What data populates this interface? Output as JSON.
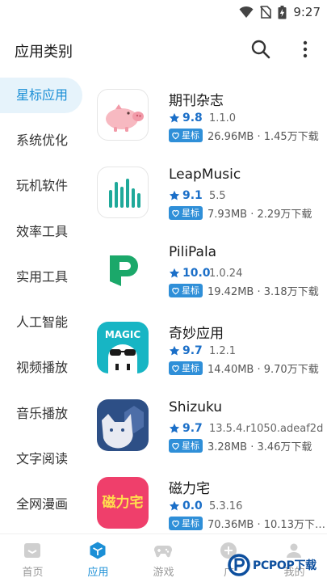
{
  "status_bar": {
    "time": "9:27"
  },
  "header": {
    "title": "应用类别"
  },
  "sidebar": {
    "items": [
      {
        "label": "星标应用",
        "active": true
      },
      {
        "label": "系统优化"
      },
      {
        "label": "玩机软件"
      },
      {
        "label": "效率工具"
      },
      {
        "label": "实用工具"
      },
      {
        "label": "人工智能"
      },
      {
        "label": "视频播放"
      },
      {
        "label": "音乐播放"
      },
      {
        "label": "文字阅读"
      },
      {
        "label": "全网漫画"
      }
    ]
  },
  "apps": [
    {
      "name": "期刊杂志",
      "score": "9.8",
      "version": "1.1.0",
      "badge": "星标",
      "meta": "26.96MB · 1.45万下载"
    },
    {
      "name": "LeapMusic",
      "score": "9.1",
      "version": "5.5",
      "badge": "星标",
      "meta": "7.93MB · 2.29万下载"
    },
    {
      "name": "PiliPala",
      "score": "10.0",
      "version": "1.0.24",
      "badge": "星标",
      "meta": "19.42MB · 3.18万下载"
    },
    {
      "name": "奇妙应用",
      "score": "9.7",
      "version": "1.2.1",
      "badge": "星标",
      "meta": "14.40MB · 9.70万下载",
      "icon_text": "MAGIC"
    },
    {
      "name": "Shizuku",
      "score": "9.7",
      "version": "13.5.4.r1050.adeaf2d",
      "badge": "星标",
      "meta": "3.28MB · 3.46万下载"
    },
    {
      "name": "磁力宅",
      "score": "0.0",
      "version": "5.3.16",
      "badge": "星标",
      "meta": "70.36MB · 10.13万下…",
      "icon_text": "磁力宅"
    }
  ],
  "tabs": [
    {
      "label": "首页"
    },
    {
      "label": "应用",
      "active": true
    },
    {
      "label": "游戏"
    },
    {
      "label": "广"
    },
    {
      "label": "我的"
    }
  ],
  "watermark": {
    "text": "PCPOP下载"
  },
  "colors": {
    "accent": "#1b8fd6",
    "badge": "#2f8fd8",
    "sidebar_active_bg": "#e6f3fb"
  }
}
